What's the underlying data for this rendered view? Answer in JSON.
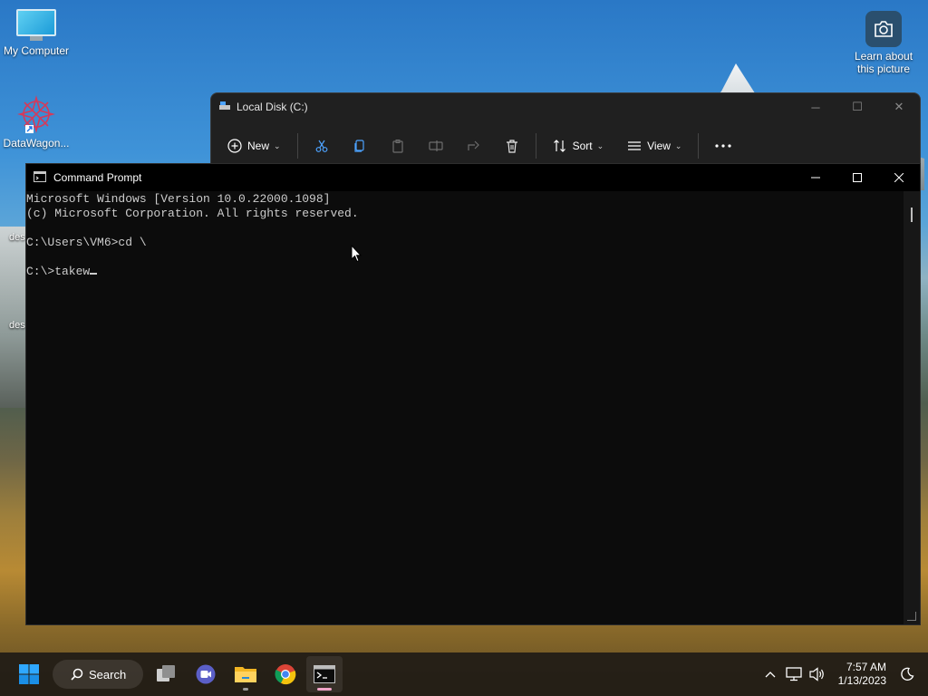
{
  "desktop": {
    "icons": [
      {
        "label": "My Computer",
        "icon": "monitor-icon"
      },
      {
        "label": "DataWagon...",
        "icon": "datawagon-icon"
      },
      {
        "label": "Learn about this picture",
        "icon": "camera-icon"
      }
    ],
    "partial_labels": [
      "des",
      "des"
    ]
  },
  "explorer": {
    "title": "Local Disk (C:)",
    "toolbar": {
      "new_label": "New",
      "sort_label": "Sort",
      "view_label": "View"
    },
    "controls": {
      "minimize": "─",
      "maximize": "☐",
      "close": "✕"
    }
  },
  "cmd": {
    "title": "Command Prompt",
    "lines": [
      "Microsoft Windows [Version 10.0.22000.1098]",
      "(c) Microsoft Corporation. All rights reserved.",
      "",
      "C:\\Users\\VM6>cd \\",
      "",
      "C:\\>takew"
    ]
  },
  "taskbar": {
    "search_label": "Search",
    "apps": [
      "start-icon",
      "task-view-icon",
      "teams-chat-icon",
      "file-explorer-icon",
      "chrome-icon",
      "command-prompt-icon"
    ],
    "time": "7:57 AM",
    "date": "1/13/2023"
  },
  "colors": {
    "cmd_bg": "#0c0c0c",
    "cmd_text": "#cccccc",
    "explorer_bg": "#202020",
    "start_blue": "#0a84ff"
  }
}
